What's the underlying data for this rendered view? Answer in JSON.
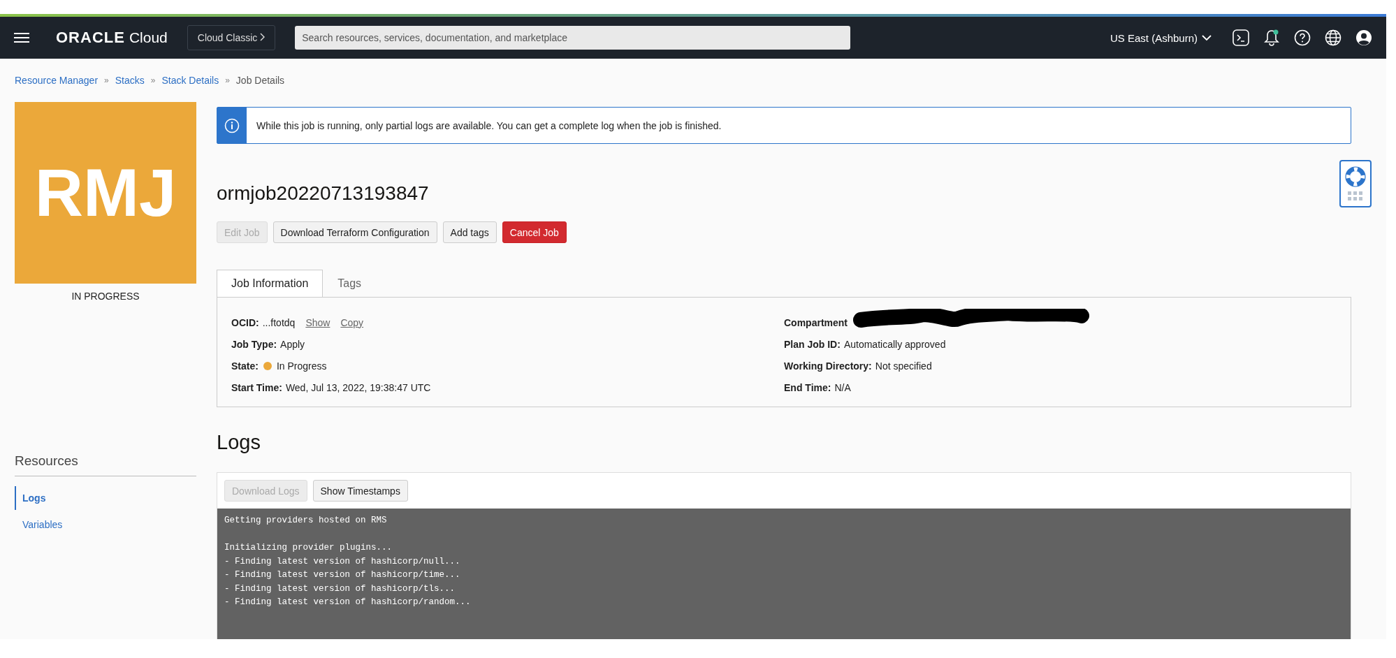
{
  "header": {
    "brand": "ORACLE",
    "product": "Cloud",
    "console_switch": "Cloud Classic",
    "search": {
      "placeholder": "Search resources, services, documentation, and marketplace"
    },
    "region": "US East (Ashburn)",
    "notifications_unread": true
  },
  "breadcrumbs": [
    {
      "label": "Resource Manager",
      "link": true
    },
    {
      "separator": "»",
      "label": "Stacks",
      "link": true
    },
    {
      "separator": "»",
      "label": "Stack Details",
      "link": true
    },
    {
      "separator": "»",
      "label": "Job Details",
      "link": false
    }
  ],
  "tile": {
    "initials": "RMJ",
    "status": "IN PROGRESS",
    "color": "#eba83a"
  },
  "banner": {
    "text": "While this job is running, only partial logs are available. You can get a complete log when the job is finished."
  },
  "title": "ormjob20220713193847",
  "actions": [
    {
      "label": "Edit Job",
      "kind": "default",
      "disabled": true
    },
    {
      "label": "Download Terraform Configuration",
      "kind": "default",
      "disabled": false
    },
    {
      "label": "Add tags",
      "kind": "default",
      "disabled": false
    },
    {
      "label": "Cancel Job",
      "kind": "danger",
      "disabled": false
    }
  ],
  "tabs": [
    {
      "label": "Job Information",
      "selected": true
    },
    {
      "label": "Tags",
      "selected": false
    }
  ],
  "info_left": [
    {
      "label": "OCID:",
      "value": "...ftotdq",
      "links": [
        "Show",
        "Copy"
      ]
    },
    {
      "label": "Job Type:",
      "value": "Apply"
    },
    {
      "label": "State:",
      "value": "In Progress",
      "color": "#eba83a"
    },
    {
      "label": "Start Time:",
      "value": "Wed, Jul 13, 2022, 19:38:47 UTC"
    }
  ],
  "info_right": [
    {
      "label": "Compartment",
      "redacted": true
    },
    {
      "label": "Plan Job ID:",
      "value": "Automatically approved"
    },
    {
      "label": "Working Directory:",
      "value": "Not specified"
    },
    {
      "label": "End Time:",
      "value": "N/A"
    }
  ],
  "resources": {
    "title": "Resources",
    "items": [
      {
        "label": "Logs",
        "selected": true
      },
      {
        "label": "Variables",
        "selected": false
      }
    ]
  },
  "logs": {
    "title": "Logs",
    "buttons": [
      {
        "label": "Download Logs",
        "disabled": true
      },
      {
        "label": "Show Timestamps",
        "disabled": false
      }
    ],
    "blocks": [
      [
        "Getting providers hosted on RMS"
      ],
      [
        "Initializing provider plugins...",
        "- Finding latest version of hashicorp/null...",
        "- Finding latest version of hashicorp/time...",
        "- Finding latest version of hashicorp/tls...",
        "- Finding latest version of hashicorp/random..."
      ]
    ]
  }
}
